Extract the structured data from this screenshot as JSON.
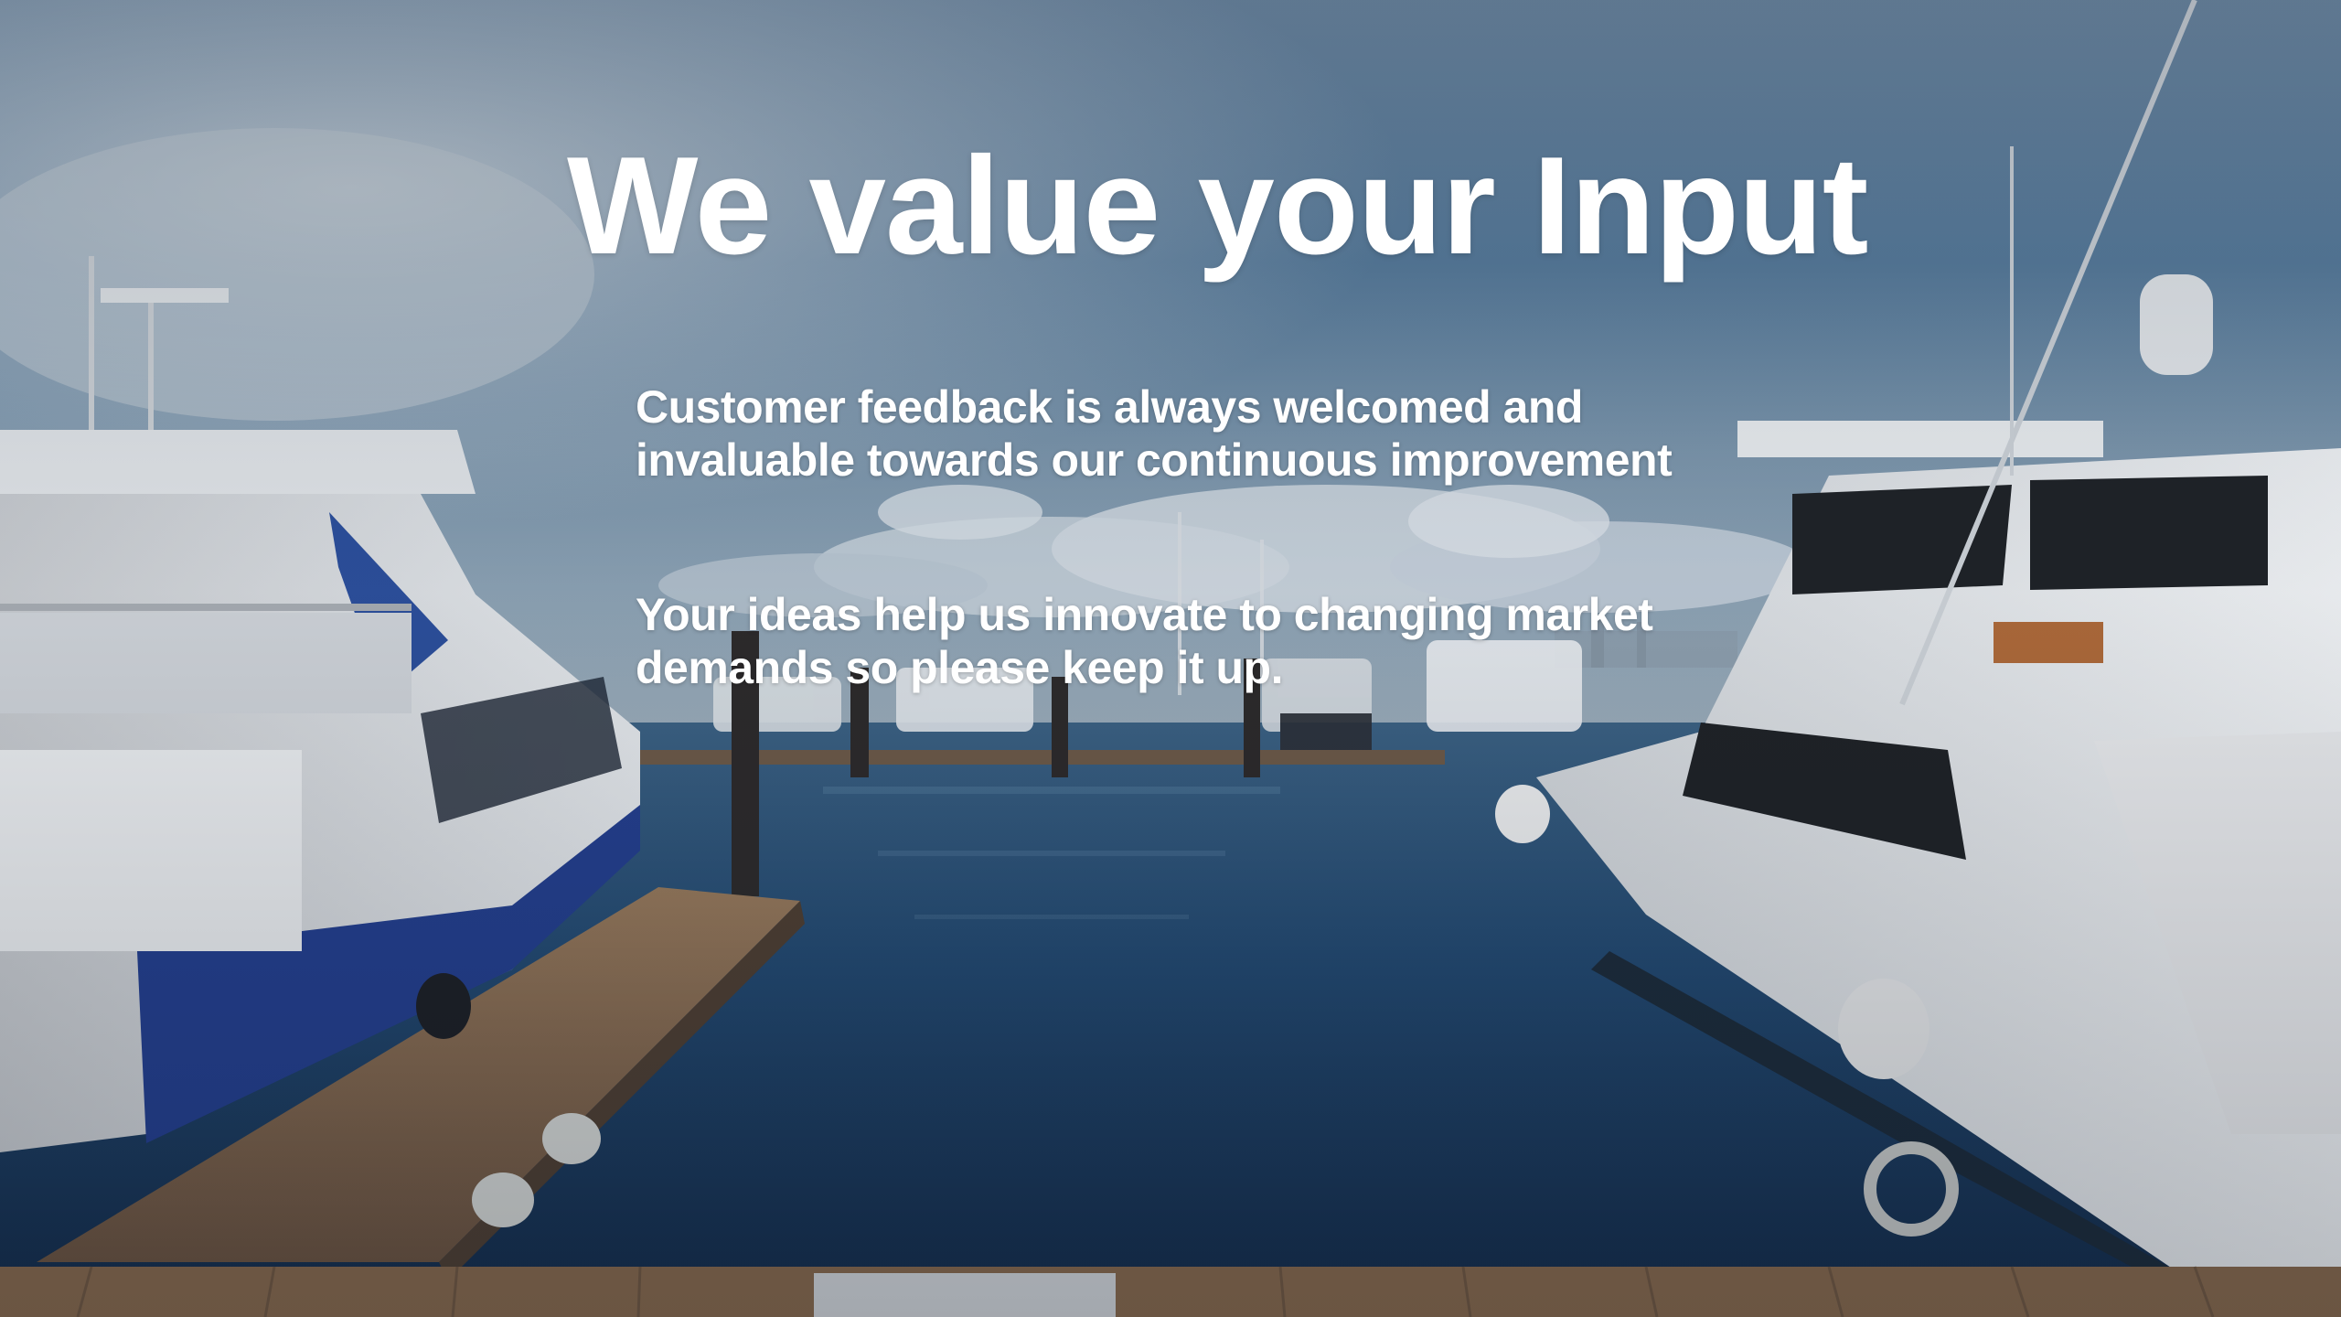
{
  "slide": {
    "title": "We value your Input",
    "paragraph_1_line_1": "Customer feedback is always welcomed and",
    "paragraph_1_line_2": "invaluable towards our continuous improvement",
    "paragraph_2_line_1": "Your ideas help us innovate to changing market",
    "paragraph_2_line_2": "demands so please keep it up."
  },
  "background": {
    "image_subject": "marina-with-yachts-photo",
    "sky_color": "#5c7e9d",
    "water_color": "#1f3f6a",
    "dock_color": "#8a6b4e",
    "text_color": "#ffffff"
  }
}
